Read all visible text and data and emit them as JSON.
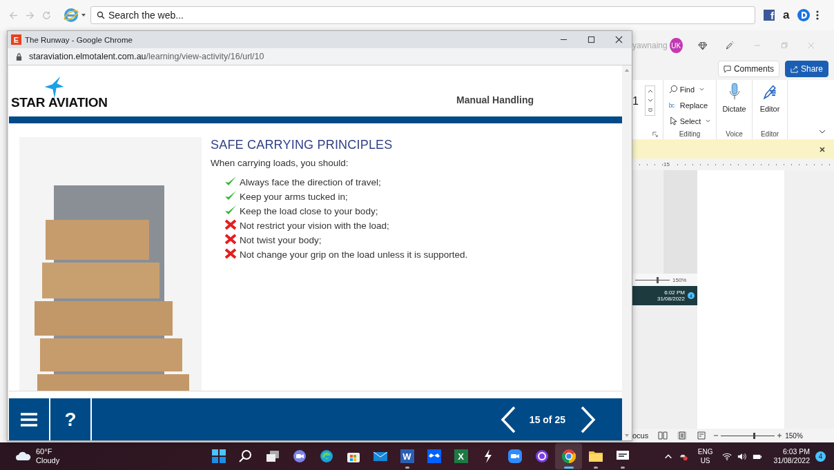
{
  "browser": {
    "search": {
      "placeholder": "Search the web..."
    },
    "amazon_letter": "a",
    "facebook_letter": "f"
  },
  "popup": {
    "title": "The Runway - Google Chrome",
    "favicon_letter": "E",
    "url_domain": "staraviation.elmotalent.com.au",
    "url_path": "/learning/view-activity/16/url/10"
  },
  "course": {
    "logo_left": "STAR",
    "logo_right": "AVIATION",
    "module": "Manual Handling",
    "heading": "SAFE CARRYING PRINCIPLES",
    "intro": "When carrying loads, you should:",
    "items": [
      {
        "text": "Always face the direction of travel;",
        "kind": "do"
      },
      {
        "text": "Keep your arms tucked in;",
        "kind": "do"
      },
      {
        "text": "Keep the load close to your body;",
        "kind": "do"
      },
      {
        "text": "Not restrict your vision with the load;",
        "kind": "dont"
      },
      {
        "text": "Not twist your body;",
        "kind": "dont"
      },
      {
        "text": "Not change your grip on the load unless it is supported.",
        "kind": "dont"
      }
    ],
    "help": "?",
    "page": "15 of 25"
  },
  "word": {
    "user": "yawnaing",
    "avatar": "UK",
    "comments": "Comments",
    "share": "Share",
    "font_size": "1",
    "find": "Find",
    "replace": "Replace",
    "replace_letters": "bc",
    "select": "Select",
    "dictate": "Dictate",
    "editor": "Editor",
    "groups": [
      "Editing",
      "Voice",
      "Editor"
    ],
    "ruler_mark": "15",
    "inset": {
      "zoom": "150%",
      "level": 0.62,
      "time": "6:02 PM",
      "date": "31/08/2022",
      "badge": "4"
    },
    "status": {
      "focus": "ocus",
      "zoom": "150%",
      "level": 0.6
    }
  },
  "taskbar": {
    "temp": "60°F",
    "weather": "Cloudy",
    "lang": "ENG",
    "region": "US",
    "time": "6:03 PM",
    "date": "31/08/2022",
    "badge": "4",
    "apps": [
      {
        "kind": "start",
        "running": false,
        "selected": false
      },
      {
        "kind": "search",
        "running": false,
        "selected": false
      },
      {
        "kind": "taskview",
        "running": false,
        "selected": false
      },
      {
        "kind": "chat",
        "running": false,
        "selected": false
      },
      {
        "kind": "edge",
        "running": false,
        "selected": false
      },
      {
        "kind": "store",
        "running": false,
        "selected": false
      },
      {
        "kind": "mail",
        "running": false,
        "selected": false
      },
      {
        "kind": "word",
        "letter": "W",
        "running": true,
        "selected": false
      },
      {
        "kind": "dropbox",
        "running": false,
        "selected": false
      },
      {
        "kind": "excel",
        "letter": "X",
        "running": false,
        "selected": false
      },
      {
        "kind": "bolt",
        "running": false,
        "selected": false
      },
      {
        "kind": "camera",
        "running": false,
        "selected": false
      },
      {
        "kind": "ring",
        "running": false,
        "selected": false
      },
      {
        "kind": "chrome",
        "running": true,
        "selected": true
      },
      {
        "kind": "folder",
        "running": true,
        "selected": false
      },
      {
        "kind": "board",
        "running": true,
        "selected": false
      }
    ]
  }
}
